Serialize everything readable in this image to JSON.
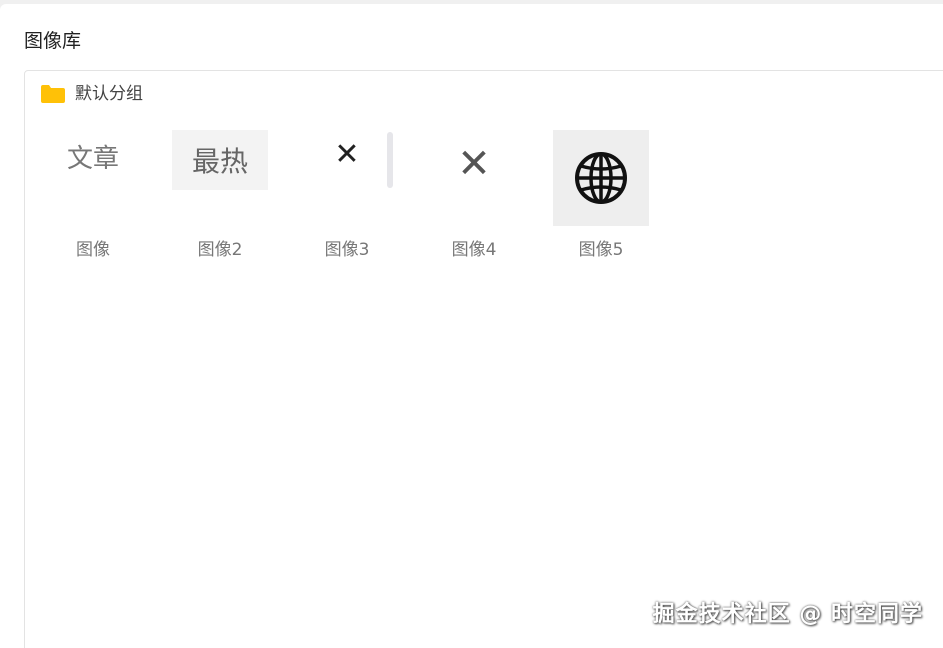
{
  "panel": {
    "title": "图像库"
  },
  "group": {
    "label": "默认分组",
    "icon": "folder-icon",
    "folder_color": "#FFC107"
  },
  "images": [
    {
      "caption": "图像",
      "thumb_text": "文章",
      "thumb_kind": "text"
    },
    {
      "caption": "图像2",
      "thumb_text": "最热",
      "thumb_kind": "text"
    },
    {
      "caption": "图像3",
      "thumb_text": "✕",
      "thumb_kind": "close-icon"
    },
    {
      "caption": "图像4",
      "thumb_text": "✕",
      "thumb_kind": "close-icon"
    },
    {
      "caption": "图像5",
      "thumb_text": "",
      "thumb_kind": "globe-icon"
    }
  ],
  "watermark": "掘金技术社区 @ 时空同学"
}
